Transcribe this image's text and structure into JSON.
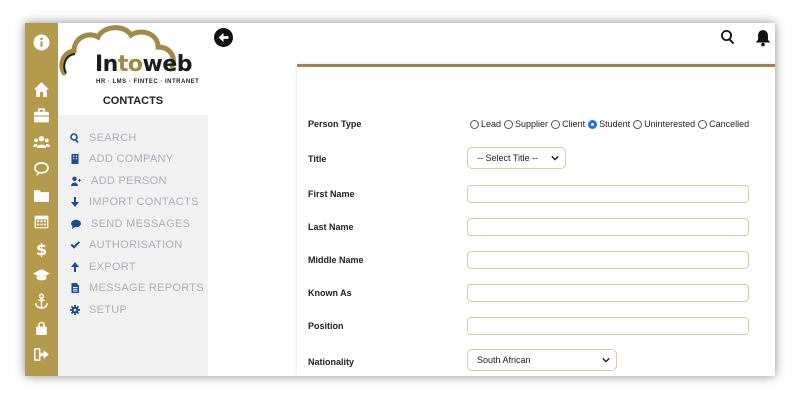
{
  "logo": {
    "word_start": "In",
    "word_mid": "to",
    "word_end": "web",
    "tagline": "HR · LMS · FINTEC · INTRANET"
  },
  "section_title": "CONTACTS",
  "rail_icons": [
    "info-icon",
    "home-icon",
    "briefcase-icon",
    "users-icon",
    "chat-icon",
    "folder-icon",
    "calendar-icon",
    "dollar-icon",
    "graduation-cap-icon",
    "anchor-icon",
    "lock-icon",
    "sign-out-icon"
  ],
  "menu": [
    {
      "label": "SEARCH",
      "icon": "search-icon"
    },
    {
      "label": "ADD COMPANY",
      "icon": "building-icon"
    },
    {
      "label": "ADD PERSON",
      "icon": "user-plus-icon"
    },
    {
      "label": "IMPORT CONTACTS",
      "icon": "arrow-down-icon"
    },
    {
      "label": "SEND MESSAGES",
      "icon": "comment-icon"
    },
    {
      "label": "AUTHORISATION",
      "icon": "check-icon"
    },
    {
      "label": "EXPORT",
      "icon": "arrow-up-icon"
    },
    {
      "label": "MESSAGE REPORTS",
      "icon": "report-icon"
    },
    {
      "label": "SETUP",
      "icon": "gear-icon"
    }
  ],
  "form": {
    "person_type_label": "Person Type",
    "person_types": [
      "Lead",
      "Supplier",
      "Client",
      "Student",
      "Uninterested",
      "Cancelled"
    ],
    "person_type_selected": "Student",
    "title_label": "Title",
    "title_value": "-- Select Title --",
    "first_name_label": "First Name",
    "first_name_value": "",
    "last_name_label": "Last Name",
    "last_name_value": "",
    "middle_name_label": "Middle Name",
    "middle_name_value": "",
    "known_as_label": "Known As",
    "known_as_value": "",
    "position_label": "Position",
    "position_value": "",
    "nationality_label": "Nationality",
    "nationality_value": "South African"
  },
  "colors": {
    "rail": "#b39a4d",
    "accent": "#9b8550",
    "menu_icon": "#1b4d8f",
    "menu_text": "#aab0b9"
  }
}
